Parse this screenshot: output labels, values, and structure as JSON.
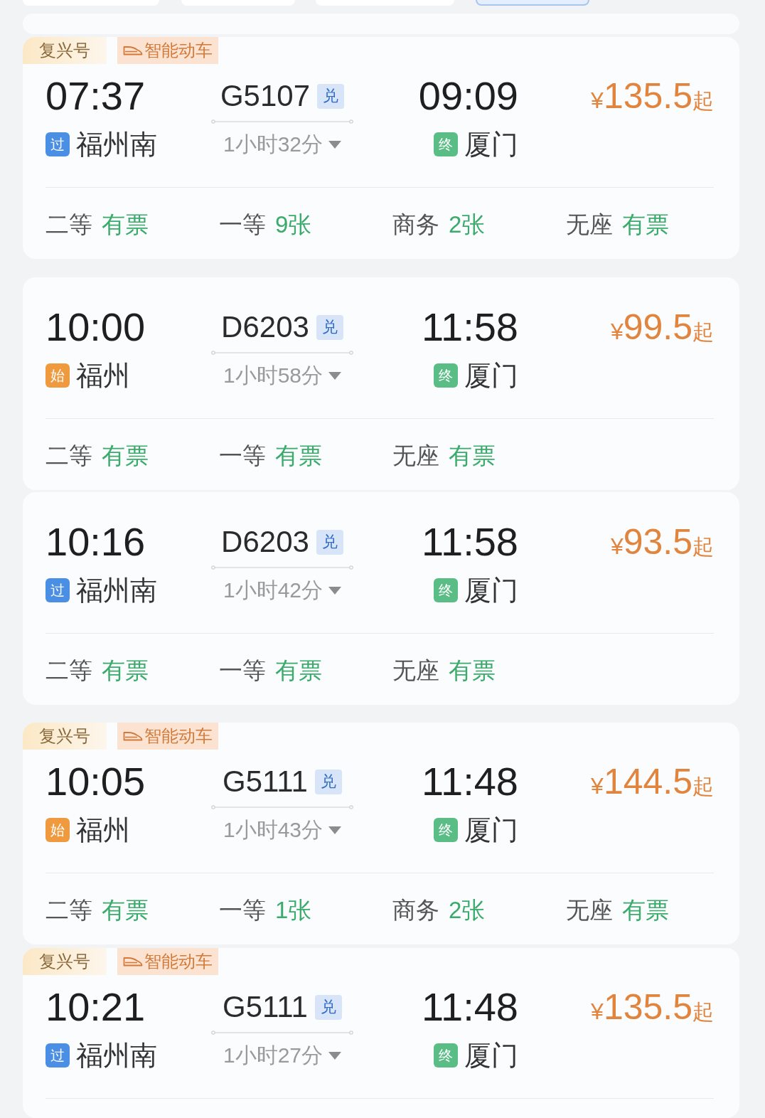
{
  "filter_chips": [
    {
      "selected": false
    },
    {
      "selected": false
    },
    {
      "selected": false
    },
    {
      "selected": true
    }
  ],
  "cards": [
    {
      "badges": [
        {
          "kind": "series",
          "label": "复兴号"
        },
        {
          "kind": "feature",
          "label": "智能动车"
        }
      ],
      "departure": {
        "time": "07:37",
        "tag": "过",
        "color": "#4a8fe3",
        "station": "福州南"
      },
      "train": {
        "number": "G5107",
        "tag": "兑",
        "duration": "1小时32分"
      },
      "arrival": {
        "time": "09:09",
        "tag": "终",
        "color": "#5bbd86",
        "station": "厦门"
      },
      "price": {
        "currency": "¥",
        "amount": "135.5",
        "suffix": "起"
      },
      "seats": [
        {
          "class": "二等",
          "availability": "有票"
        },
        {
          "class": "一等",
          "availability": "9张"
        },
        {
          "class": "商务",
          "availability": "2张"
        },
        {
          "class": "无座",
          "availability": "有票"
        }
      ]
    },
    {
      "departure": {
        "time": "10:00",
        "tag": "始",
        "color": "#ef9a3f",
        "station": "福州"
      },
      "train": {
        "number": "D6203",
        "tag": "兑",
        "duration": "1小时58分"
      },
      "arrival": {
        "time": "11:58",
        "tag": "终",
        "color": "#5bbd86",
        "station": "厦门"
      },
      "price": {
        "currency": "¥",
        "amount": "99.5",
        "suffix": "起"
      },
      "seats": [
        {
          "class": "二等",
          "availability": "有票"
        },
        {
          "class": "一等",
          "availability": "有票"
        },
        {
          "class": "无座",
          "availability": "有票"
        }
      ]
    },
    {
      "departure": {
        "time": "10:16",
        "tag": "过",
        "color": "#4a8fe3",
        "station": "福州南"
      },
      "train": {
        "number": "D6203",
        "tag": "兑",
        "duration": "1小时42分"
      },
      "arrival": {
        "time": "11:58",
        "tag": "终",
        "color": "#5bbd86",
        "station": "厦门"
      },
      "price": {
        "currency": "¥",
        "amount": "93.5",
        "suffix": "起"
      },
      "seats": [
        {
          "class": "二等",
          "availability": "有票"
        },
        {
          "class": "一等",
          "availability": "有票"
        },
        {
          "class": "无座",
          "availability": "有票"
        }
      ]
    },
    {
      "badges": [
        {
          "kind": "series",
          "label": "复兴号"
        },
        {
          "kind": "feature",
          "label": "智能动车"
        }
      ],
      "departure": {
        "time": "10:05",
        "tag": "始",
        "color": "#ef9a3f",
        "station": "福州"
      },
      "train": {
        "number": "G5111",
        "tag": "兑",
        "duration": "1小时43分"
      },
      "arrival": {
        "time": "11:48",
        "tag": "终",
        "color": "#5bbd86",
        "station": "厦门"
      },
      "price": {
        "currency": "¥",
        "amount": "144.5",
        "suffix": "起"
      },
      "seats": [
        {
          "class": "二等",
          "availability": "有票"
        },
        {
          "class": "一等",
          "availability": "1张"
        },
        {
          "class": "商务",
          "availability": "2张"
        },
        {
          "class": "无座",
          "availability": "有票"
        }
      ]
    },
    {
      "badges": [
        {
          "kind": "series",
          "label": "复兴号"
        },
        {
          "kind": "feature",
          "label": "智能动车"
        }
      ],
      "departure": {
        "time": "10:21",
        "tag": "过",
        "color": "#4a8fe3",
        "station": "福州南"
      },
      "train": {
        "number": "G5111",
        "tag": "兑",
        "duration": "1小时27分"
      },
      "arrival": {
        "time": "11:48",
        "tag": "终",
        "color": "#5bbd86",
        "station": "厦门"
      },
      "price": {
        "currency": "¥",
        "amount": "135.5",
        "suffix": "起"
      }
    }
  ]
}
